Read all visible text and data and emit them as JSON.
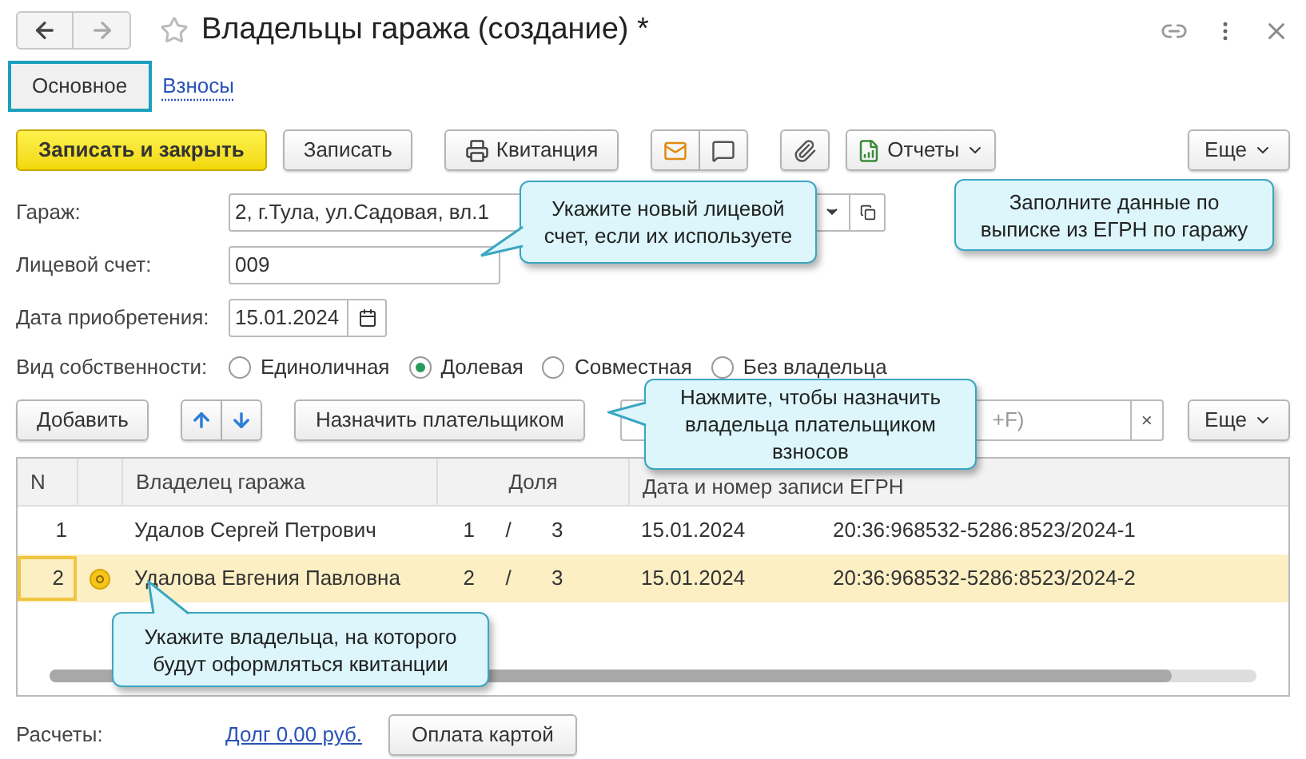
{
  "window": {
    "title": "Владельцы гаража (создание) *"
  },
  "tabs": [
    {
      "label": "Основное",
      "selected": true
    },
    {
      "label": "Взносы",
      "selected": false
    }
  ],
  "toolbar": {
    "primary": "Записать и закрыть",
    "save": "Записать",
    "receipt": "Квитанция",
    "reports": "Отчеты",
    "more": "Еще"
  },
  "fields": [
    {
      "kind": "select",
      "label": "Гараж:",
      "value": "2, г.Тула, ул.Садовая, вл.1"
    },
    {
      "kind": "text",
      "label": "Лицевой счет:",
      "value": "009"
    },
    {
      "kind": "date",
      "label": "Дата приобретения:",
      "value": "15.01.2024"
    }
  ],
  "ownership": {
    "label": "Вид собственности:",
    "options": [
      {
        "label": "Единоличная",
        "selected": false
      },
      {
        "label": "Долевая",
        "selected": true
      },
      {
        "label": "Совместная",
        "selected": false
      },
      {
        "label": "Без владельца",
        "selected": false
      }
    ]
  },
  "table_toolbar": {
    "add": "Добавить",
    "assign": "Назначить плательщиком",
    "search": "+F)",
    "clear": "×",
    "more": "Еще"
  },
  "table": {
    "columns": [
      "N",
      "Владелец гаража",
      "Доля",
      "Дата и номер записи ЕГРН"
    ],
    "rows": [
      {
        "n": "1",
        "owner": "Удалов Сергей Петрович",
        "payer": false,
        "share_num": "1",
        "share_sep": "/",
        "share_den": "3",
        "date": "15.01.2024",
        "record": "20:36:968532-5286:8523/2024-1",
        "selected": false
      },
      {
        "n": "2",
        "owner": "Удалова Евгения Павловна",
        "payer": true,
        "share_num": "2",
        "share_sep": "/",
        "share_den": "3",
        "date": "15.01.2024",
        "record": "20:36:968532-5286:8523/2024-2",
        "selected": true
      }
    ]
  },
  "footer": {
    "label": "Расчеты:",
    "link": "Долг 0,00 руб.",
    "button": "Оплата картой"
  },
  "callouts": [
    {
      "text": "Укажите новый лицевой счет, если их используете"
    },
    {
      "text": "Заполните данные по выписке из ЕГРН по гаражу"
    },
    {
      "text": "Нажмите, чтобы назначить владельца плательщиком взносов"
    },
    {
      "text": "Укажите владельца, на которого будут оформляться квитанции"
    }
  ]
}
